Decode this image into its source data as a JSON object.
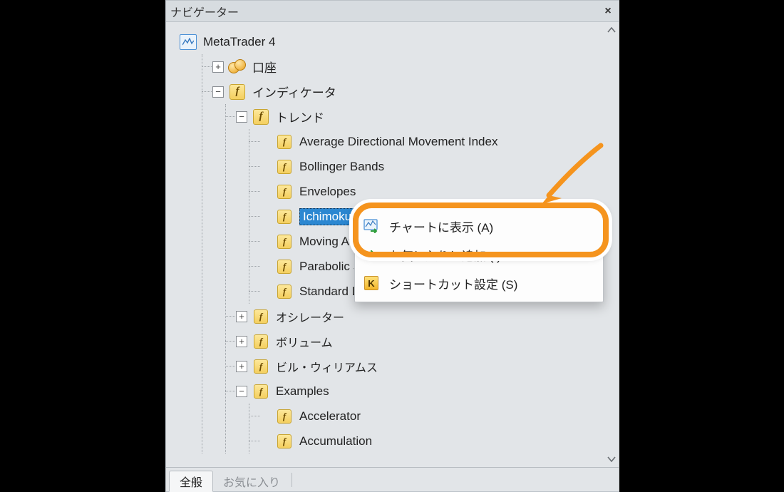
{
  "panel": {
    "title": "ナビゲーター",
    "close_glyph": "×"
  },
  "tree": {
    "root_label": "MetaTrader 4",
    "accounts": {
      "label": "口座"
    },
    "indicators": {
      "label": "インディケータ",
      "trend": {
        "label": "トレンド",
        "items": [
          "Average Directional Movement Index",
          "Bollinger Bands",
          "Envelopes",
          "Ichimoku Kinko Hyo",
          "Moving Average",
          "Parabolic SAR",
          "Standard Deviation"
        ]
      },
      "oscillators": {
        "label": "オシレーター"
      },
      "volumes": {
        "label": "ボリューム"
      },
      "bill_williams": {
        "label": "ビル・ウィリアムス"
      },
      "examples": {
        "label": "Examples",
        "items": [
          "Accelerator",
          "Accumulation"
        ]
      }
    }
  },
  "tabs": {
    "general": "全般",
    "favorites": "お気に入り"
  },
  "context_menu": {
    "attach": "チャートに表示 (A)",
    "add_fav": "お気に入りに追加 (I)",
    "shortcut": "ショートカット設定 (S)"
  },
  "icons": {
    "f": "f",
    "k": "K",
    "plus": "+",
    "minus": "−"
  },
  "scrollbar": {
    "up": "⌃",
    "down": "⌄"
  }
}
